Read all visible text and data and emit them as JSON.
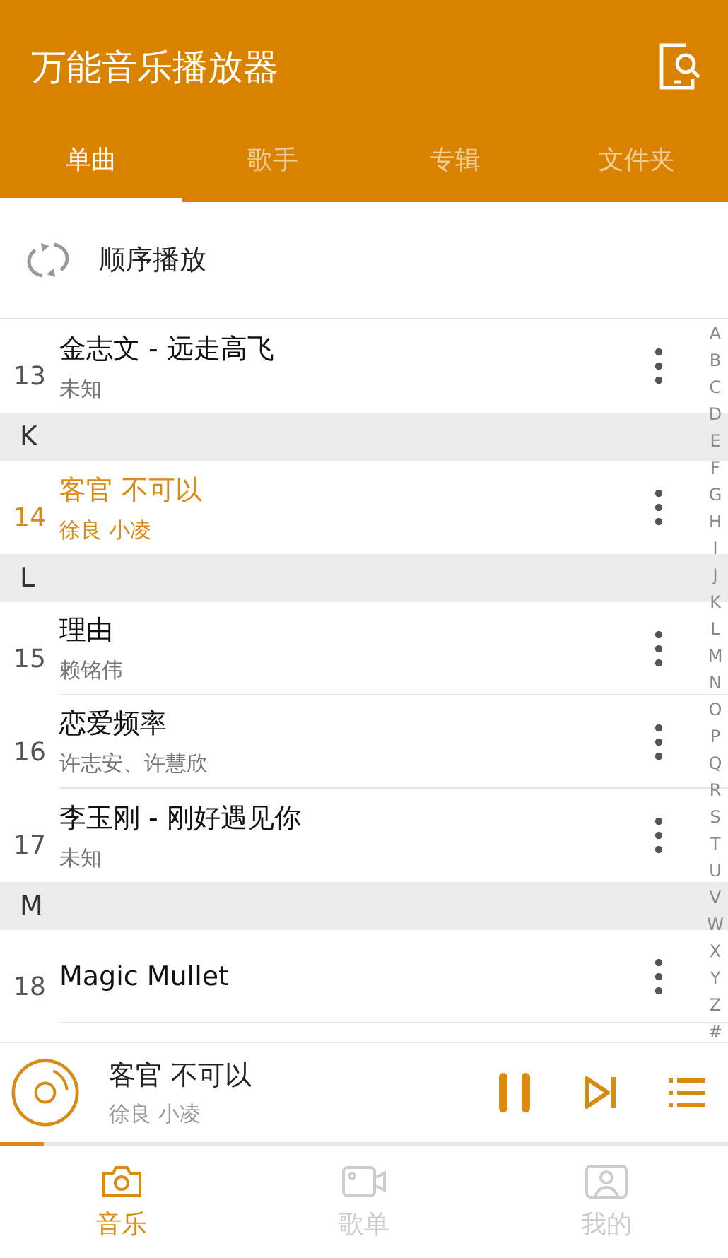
{
  "app_bar": {
    "title": "万能音乐播放器"
  },
  "tabs": [
    {
      "label": "单曲",
      "selected": true
    },
    {
      "label": "歌手",
      "selected": false
    },
    {
      "label": "专辑",
      "selected": false
    },
    {
      "label": "文件夹",
      "selected": false
    }
  ],
  "play_mode": {
    "label": "顺序播放"
  },
  "list": [
    {
      "kind": "song",
      "number": "13",
      "title": "金志文 - 远走高飞",
      "artist": "未知",
      "playing": false
    },
    {
      "kind": "section",
      "letter": "K"
    },
    {
      "kind": "song",
      "number": "14",
      "title": "客官 不可以",
      "artist": "徐良 小凌",
      "playing": true
    },
    {
      "kind": "section",
      "letter": "L"
    },
    {
      "kind": "song",
      "number": "15",
      "title": "理由",
      "artist": "赖铭伟",
      "playing": false
    },
    {
      "kind": "song",
      "number": "16",
      "title": "恋爱频率",
      "artist": "许志安、许慧欣",
      "playing": false
    },
    {
      "kind": "song",
      "number": "17",
      "title": "李玉刚 - 刚好遇见你",
      "artist": "未知",
      "playing": false
    },
    {
      "kind": "section",
      "letter": "M"
    },
    {
      "kind": "song",
      "number": "18",
      "title": "Magic Mullet",
      "playing": false
    }
  ],
  "index_letters": [
    "A",
    "B",
    "C",
    "D",
    "E",
    "F",
    "G",
    "H",
    "I",
    "J",
    "K",
    "L",
    "M",
    "N",
    "O",
    "P",
    "Q",
    "R",
    "S",
    "T",
    "U",
    "V",
    "W",
    "X",
    "Y",
    "Z",
    "#"
  ],
  "now_playing": {
    "title": "客官 不可以",
    "artist": "徐良 小凌",
    "playing": true,
    "level": 0.06
  },
  "bottom_nav": [
    {
      "label": "音乐",
      "kind": "camera",
      "selected": true
    },
    {
      "label": "歌单",
      "kind": "video",
      "selected": false
    },
    {
      "label": "我的",
      "kind": "person",
      "selected": false
    }
  ]
}
